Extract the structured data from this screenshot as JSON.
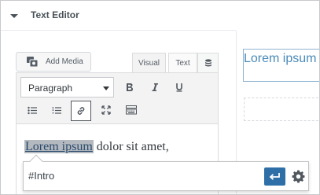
{
  "section": {
    "title": "Text Editor"
  },
  "editor": {
    "add_media_label": "Add Media",
    "tabs": [
      "Visual",
      "Text"
    ],
    "format_select_value": "Paragraph",
    "content": {
      "link_text": "Lorem ipsum",
      "rest_text": " dolor sit amet,"
    }
  },
  "link_popup": {
    "value": "#Intro"
  },
  "preview": {
    "heading_text": "Lorem ipsum"
  },
  "icons": {
    "caret": "caret-down-icon",
    "add_media": "media-icon",
    "extra_tab": "database-icon",
    "bold": "bold-icon",
    "italic": "italic-icon",
    "underline": "underline-icon",
    "bullet_list": "bullet-list-icon",
    "numbered_list": "numbered-list-icon",
    "link": "link-icon",
    "fullscreen": "fullscreen-icon",
    "toolbar_toggle": "keyboard-icon",
    "apply": "enter-icon",
    "settings": "gear-icon"
  },
  "colors": {
    "accent": "#2e6fa8",
    "preview_text": "#4a8ab8",
    "link_highlight": "#b3b9bf"
  }
}
